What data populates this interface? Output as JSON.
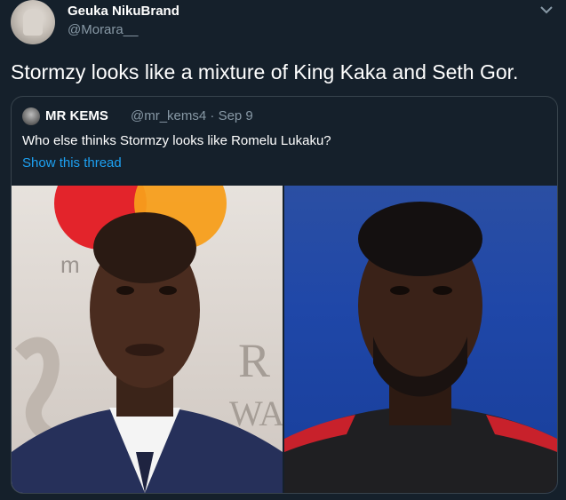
{
  "tweet": {
    "author_name": "Geuka NikuBrand",
    "author_handle": "@Morara__",
    "text": "Stormzy looks like a mixture of King Kaka and Seth Gor."
  },
  "quoted_tweet": {
    "author_name": "MR KEMS",
    "meta": "@mr_kems4 · Sep 9",
    "text": "Who else thinks Stormzy looks like Romelu Lukaku?",
    "show_thread_label": "Show this thread"
  },
  "icons": {
    "menu": "chevron-down-icon"
  },
  "colors": {
    "background": "#15202b",
    "secondary_text": "#8899a6",
    "link": "#1da1f2",
    "border": "#38444d"
  }
}
